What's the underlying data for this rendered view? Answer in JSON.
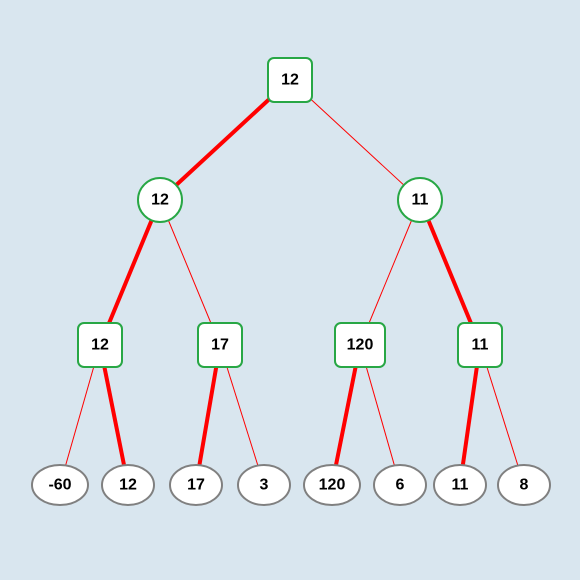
{
  "diagram": {
    "type": "minimax-tree",
    "root": {
      "shape": "square",
      "value": "12"
    },
    "level1": [
      {
        "shape": "circle",
        "value": "12",
        "edge_from_parent": "thick"
      },
      {
        "shape": "circle",
        "value": "11",
        "edge_from_parent": "thin"
      }
    ],
    "level2": [
      {
        "shape": "square",
        "value": "12",
        "edge_from_parent": "thick"
      },
      {
        "shape": "square",
        "value": "17",
        "edge_from_parent": "thin"
      },
      {
        "shape": "square",
        "value": "120",
        "edge_from_parent": "thin"
      },
      {
        "shape": "square",
        "value": "11",
        "edge_from_parent": "thick"
      }
    ],
    "leaves": [
      {
        "shape": "ellipse",
        "value": "-60",
        "edge_from_parent": "thin"
      },
      {
        "shape": "ellipse",
        "value": "12",
        "edge_from_parent": "thick"
      },
      {
        "shape": "ellipse",
        "value": "17",
        "edge_from_parent": "thick"
      },
      {
        "shape": "ellipse",
        "value": "3",
        "edge_from_parent": "thin"
      },
      {
        "shape": "ellipse",
        "value": "120",
        "edge_from_parent": "thick"
      },
      {
        "shape": "ellipse",
        "value": "6",
        "edge_from_parent": "thin"
      },
      {
        "shape": "ellipse",
        "value": "11",
        "edge_from_parent": "thick"
      },
      {
        "shape": "ellipse",
        "value": "8",
        "edge_from_parent": "thin"
      }
    ],
    "colors": {
      "background": "#d9e6ef",
      "internal_stroke": "#28a745",
      "leaf_stroke": "#808080",
      "edge": "#ff0000"
    }
  }
}
